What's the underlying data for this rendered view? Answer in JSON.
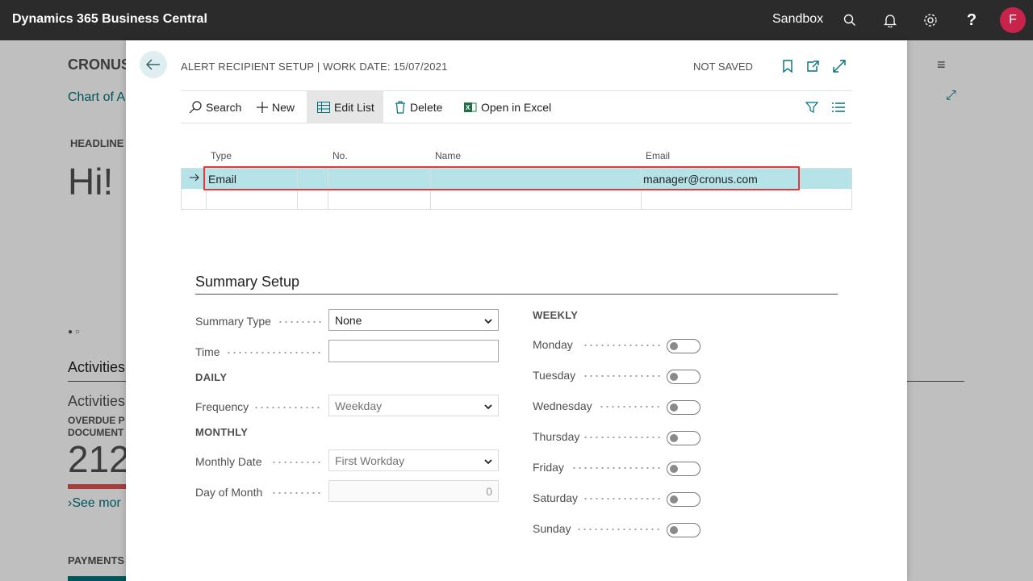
{
  "topbar": {
    "title": "Dynamics 365 Business Central",
    "environment": "Sandbox",
    "user_initial": "F"
  },
  "background": {
    "company": "CRONUS",
    "link": "Chart of A",
    "headline_label": "HEADLINE",
    "greeting": "Hi!",
    "activities_heading": "Activities",
    "activities_sub": "Activities",
    "overdue_line1": "OVERDUE P",
    "overdue_line2": "DOCUMENT",
    "overdue_value": "212",
    "see_more": "See mor",
    "payments": "PAYMENTS"
  },
  "dialog": {
    "title": "ALERT RECIPIENT SETUP | WORK DATE: 15/07/2021",
    "status": "NOT SAVED",
    "actions": {
      "search": "Search",
      "new": "New",
      "edit_list": "Edit List",
      "delete": "Delete",
      "open_in_excel": "Open in Excel"
    },
    "grid": {
      "headers": {
        "type": "Type",
        "no": "No.",
        "name": "Name",
        "email": "Email"
      },
      "rows": [
        {
          "type": "Email",
          "no": "",
          "name": "",
          "email": "manager@cronus.com"
        }
      ]
    },
    "summary": {
      "title": "Summary Setup",
      "summary_type_label": "Summary Type",
      "summary_type_value": "None",
      "time_label": "Time",
      "time_value": "",
      "daily_label": "DAILY",
      "frequency_label": "Frequency",
      "frequency_value": "Weekday",
      "monthly_label": "MONTHLY",
      "monthly_date_label": "Monthly Date",
      "monthly_date_value": "First Workday",
      "day_of_month_label": "Day of Month",
      "day_of_month_value": "0",
      "weekly_label": "WEEKLY",
      "days": [
        {
          "label": "Monday",
          "on": false
        },
        {
          "label": "Tuesday",
          "on": false
        },
        {
          "label": "Wednesday",
          "on": false
        },
        {
          "label": "Thursday",
          "on": false
        },
        {
          "label": "Friday",
          "on": false
        },
        {
          "label": "Saturday",
          "on": false
        },
        {
          "label": "Sunday",
          "on": false
        }
      ]
    }
  },
  "colors": {
    "accent": "#00707a",
    "selected_row": "#b6e3e8",
    "highlight_box": "#e23a3a",
    "avatar": "#c8234a"
  }
}
